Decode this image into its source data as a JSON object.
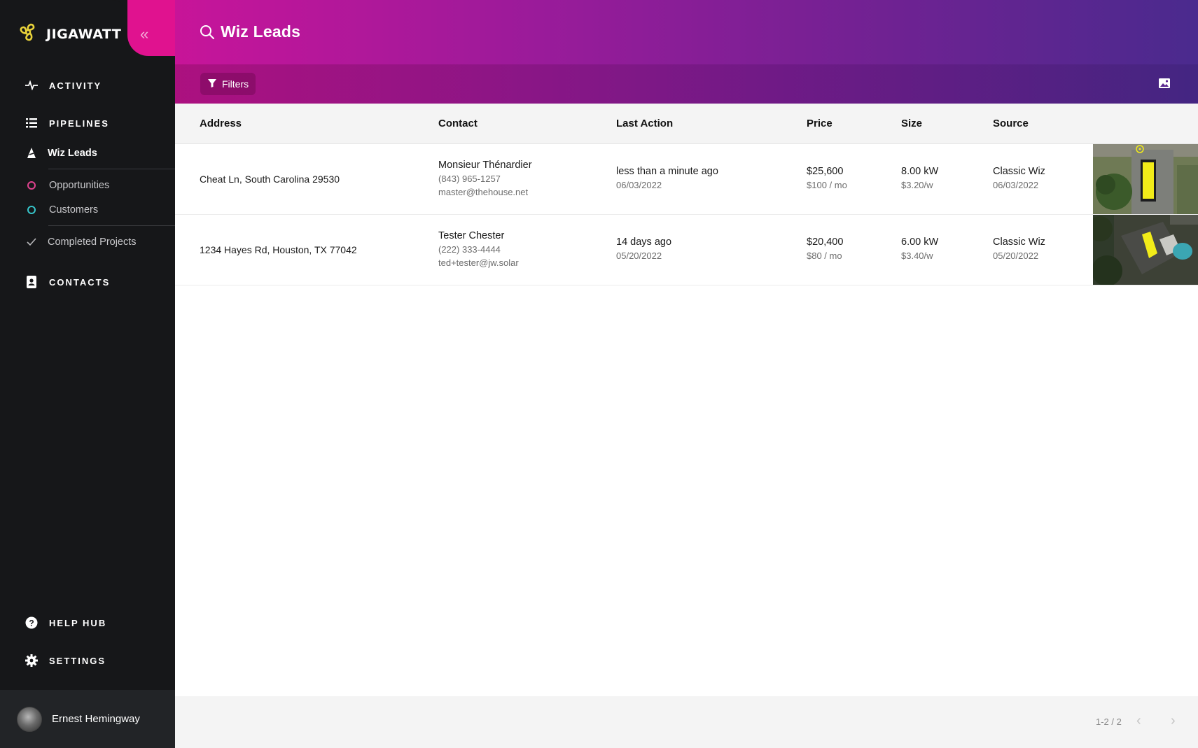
{
  "brand": {
    "name": "JIGAWATT",
    "logo_icon": "propeller-logo-icon",
    "collapse_glyph": "«"
  },
  "header": {
    "title": "Wiz Leads",
    "filters_label": "Filters"
  },
  "sidebar": {
    "sections": [
      {
        "label": "ACTIVITY",
        "icon": "pulse-icon"
      },
      {
        "label": "PIPELINES",
        "icon": "list-icon"
      },
      {
        "label": "CONTACTS",
        "icon": "contact-book-icon"
      }
    ],
    "pipeline_items": [
      {
        "label": "Wiz Leads",
        "icon": "wizard-hat-icon",
        "active": true
      },
      {
        "label": "Opportunities",
        "icon": "ring-icon",
        "color": "#e0428f"
      },
      {
        "label": "Customers",
        "icon": "ring-icon",
        "color": "#36c4c9"
      },
      {
        "label": "Completed Projects",
        "icon": "check-icon"
      }
    ],
    "bottom": [
      {
        "label": "HELP HUB",
        "icon": "help-icon"
      },
      {
        "label": "SETTINGS",
        "icon": "gear-icon"
      }
    ],
    "user": {
      "name": "Ernest Hemingway"
    }
  },
  "table": {
    "columns": [
      "Address",
      "Contact",
      "Last Action",
      "Price",
      "Size",
      "Source"
    ],
    "rows": [
      {
        "address": "Cheat Ln, South Carolina 29530",
        "contact_name": "Monsieur Thénardier",
        "contact_phone": "(843) 965-1257",
        "contact_email": "master@thehouse.net",
        "last_action": "less than a minute ago",
        "last_action_date": "06/03/2022",
        "price": "$25,600",
        "price_monthly": "$100 / mo",
        "size": "8.00 kW",
        "size_rate": "$3.20/w",
        "source": "Classic Wiz",
        "source_date": "06/03/2022"
      },
      {
        "address": "1234 Hayes Rd, Houston, TX 77042",
        "contact_name": "Tester Chester",
        "contact_phone": "(222) 333-4444",
        "contact_email": "ted+tester@jw.solar",
        "last_action": "14 days ago",
        "last_action_date": "05/20/2022",
        "price": "$20,400",
        "price_monthly": "$80 / mo",
        "size": "6.00 kW",
        "size_rate": "$3.40/w",
        "source": "Classic Wiz",
        "source_date": "05/20/2022"
      }
    ]
  },
  "pagination": {
    "text": "1-2 / 2",
    "prev_glyph": "‹",
    "next_glyph": "›"
  }
}
